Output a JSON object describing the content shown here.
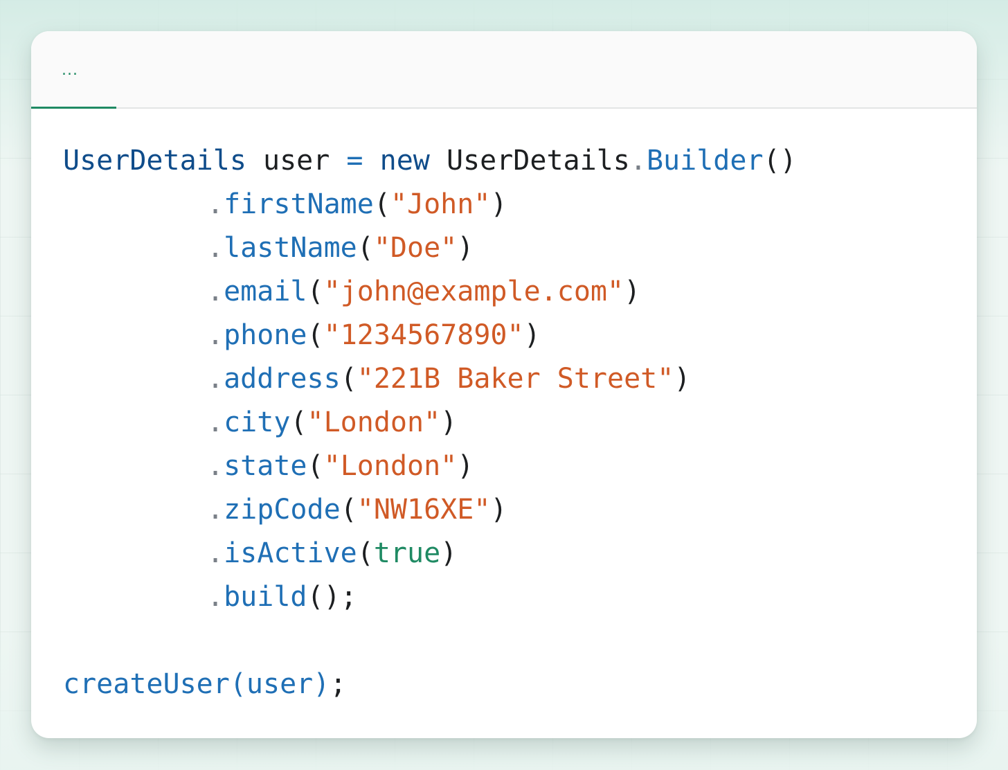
{
  "tabs": [
    {
      "label": "..."
    }
  ],
  "code": {
    "line1": {
      "type": "UserDetails",
      "var": "user",
      "op": "=",
      "kw": "new",
      "cls": "UserDetails",
      "dot": ".",
      "method": "Builder",
      "parens": "()"
    },
    "calls": [
      {
        "dot": ".",
        "method": "firstName",
        "open": "(",
        "arg": "\"John\"",
        "close": ")"
      },
      {
        "dot": ".",
        "method": "lastName",
        "open": "(",
        "arg": "\"Doe\"",
        "close": ")"
      },
      {
        "dot": ".",
        "method": "email",
        "open": "(",
        "arg": "\"john@example.com\"",
        "close": ")"
      },
      {
        "dot": ".",
        "method": "phone",
        "open": "(",
        "arg": "\"1234567890\"",
        "close": ")"
      },
      {
        "dot": ".",
        "method": "address",
        "open": "(",
        "arg": "\"221B Baker Street\"",
        "close": ")"
      },
      {
        "dot": ".",
        "method": "city",
        "open": "(",
        "arg": "\"London\"",
        "close": ")"
      },
      {
        "dot": ".",
        "method": "state",
        "open": "(",
        "arg": "\"London\"",
        "close": ")"
      },
      {
        "dot": ".",
        "method": "zipCode",
        "open": "(",
        "arg": "\"NW16XE\"",
        "close": ")"
      },
      {
        "dot": ".",
        "method": "isActive",
        "open": "(",
        "arg": "true",
        "close": ")"
      }
    ],
    "build": {
      "dot": ".",
      "method": "build",
      "tail": "();"
    },
    "last": {
      "call": "createUser(user)",
      "semi": ";"
    }
  },
  "colors": {
    "accent": "#1f8a63",
    "type": "#0f4c8a",
    "method": "#1f6fb5",
    "string": "#d05a26",
    "boolean": "#1f8a63",
    "text": "#1d1f21"
  }
}
